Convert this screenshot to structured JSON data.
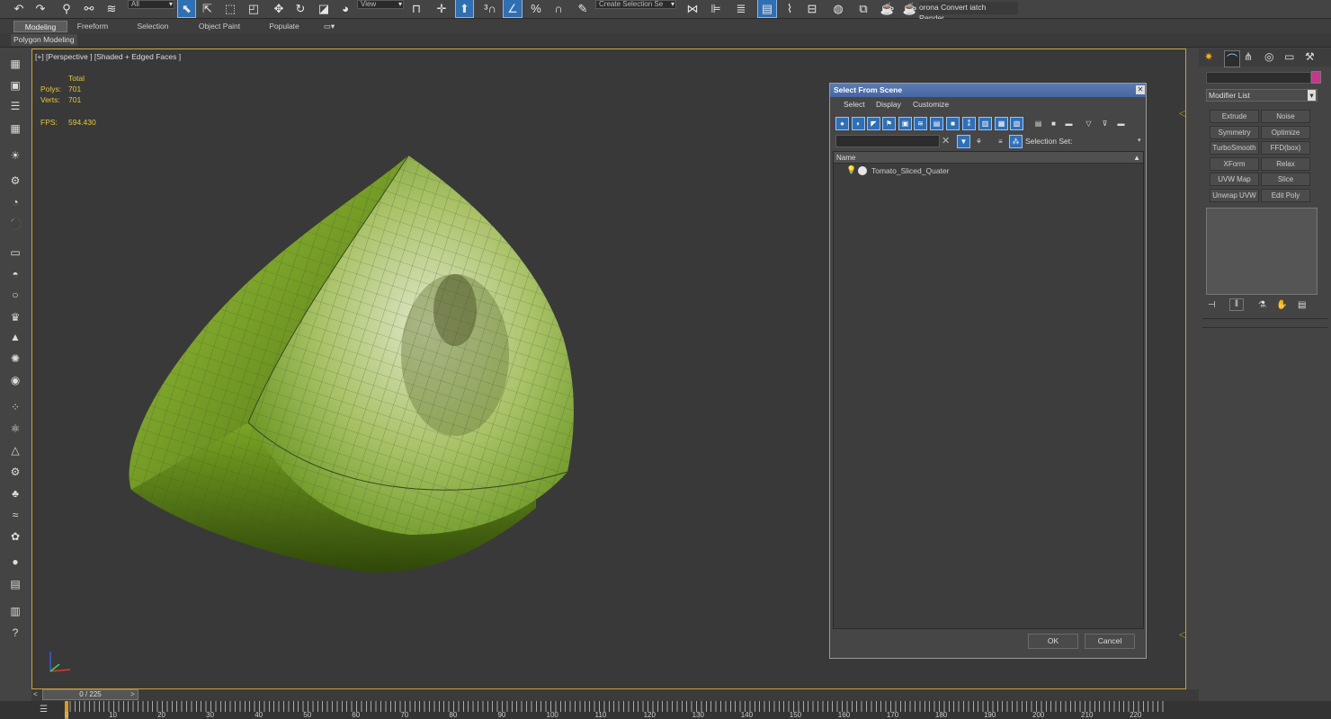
{
  "toolbar": {
    "filter_value": "All",
    "coord_value": "View",
    "named_sel_value": "Create Selection Se",
    "corona_text": "orona Convert iatch Render..."
  },
  "ribbon": {
    "tabs": [
      "Modeling",
      "Freeform",
      "Selection",
      "Object Paint",
      "Populate"
    ],
    "sub_label": "Polygon Modeling"
  },
  "viewport": {
    "label": "[+] [Perspective ] [Shaded + Edged Faces ]",
    "stats_header": "Total",
    "polys_label": "Polys:",
    "polys_value": "701",
    "verts_label": "Verts:",
    "verts_value": "701",
    "fps_label": "FPS:",
    "fps_value": "594.430"
  },
  "dialog": {
    "title": "Select From Scene",
    "menu": [
      "Select",
      "Display",
      "Customize"
    ],
    "selection_set_label": "Selection Set:",
    "column_header": "Name",
    "items": [
      "Tomato_Sliced_Quater"
    ],
    "ok_label": "OK",
    "cancel_label": "Cancel"
  },
  "command_panel": {
    "modifier_list": "Modifier List",
    "modifiers": [
      [
        "Extrude",
        "Noise"
      ],
      [
        "Symmetry",
        "Optimize"
      ],
      [
        "TurboSmooth",
        "FFD(box)"
      ],
      [
        "XForm",
        "Relax"
      ],
      [
        "UVW Map",
        "Slice"
      ],
      [
        "Unwrap UVW",
        "Edit Poly"
      ]
    ],
    "color_swatch": "#c8358a"
  },
  "time_slider": {
    "value": "0 / 225",
    "prev": "<",
    "next": ">"
  },
  "track_bar": {
    "ticks": [
      "0",
      "10",
      "20",
      "30",
      "40",
      "50",
      "60",
      "70",
      "80",
      "90",
      "100",
      "110",
      "120",
      "130",
      "140",
      "150",
      "160",
      "170",
      "180",
      "190",
      "200",
      "210",
      "220"
    ]
  },
  "colors": {
    "viewport_border": "#c9a32a",
    "stats": "#e6c83c",
    "accent": "#2e6fba"
  }
}
